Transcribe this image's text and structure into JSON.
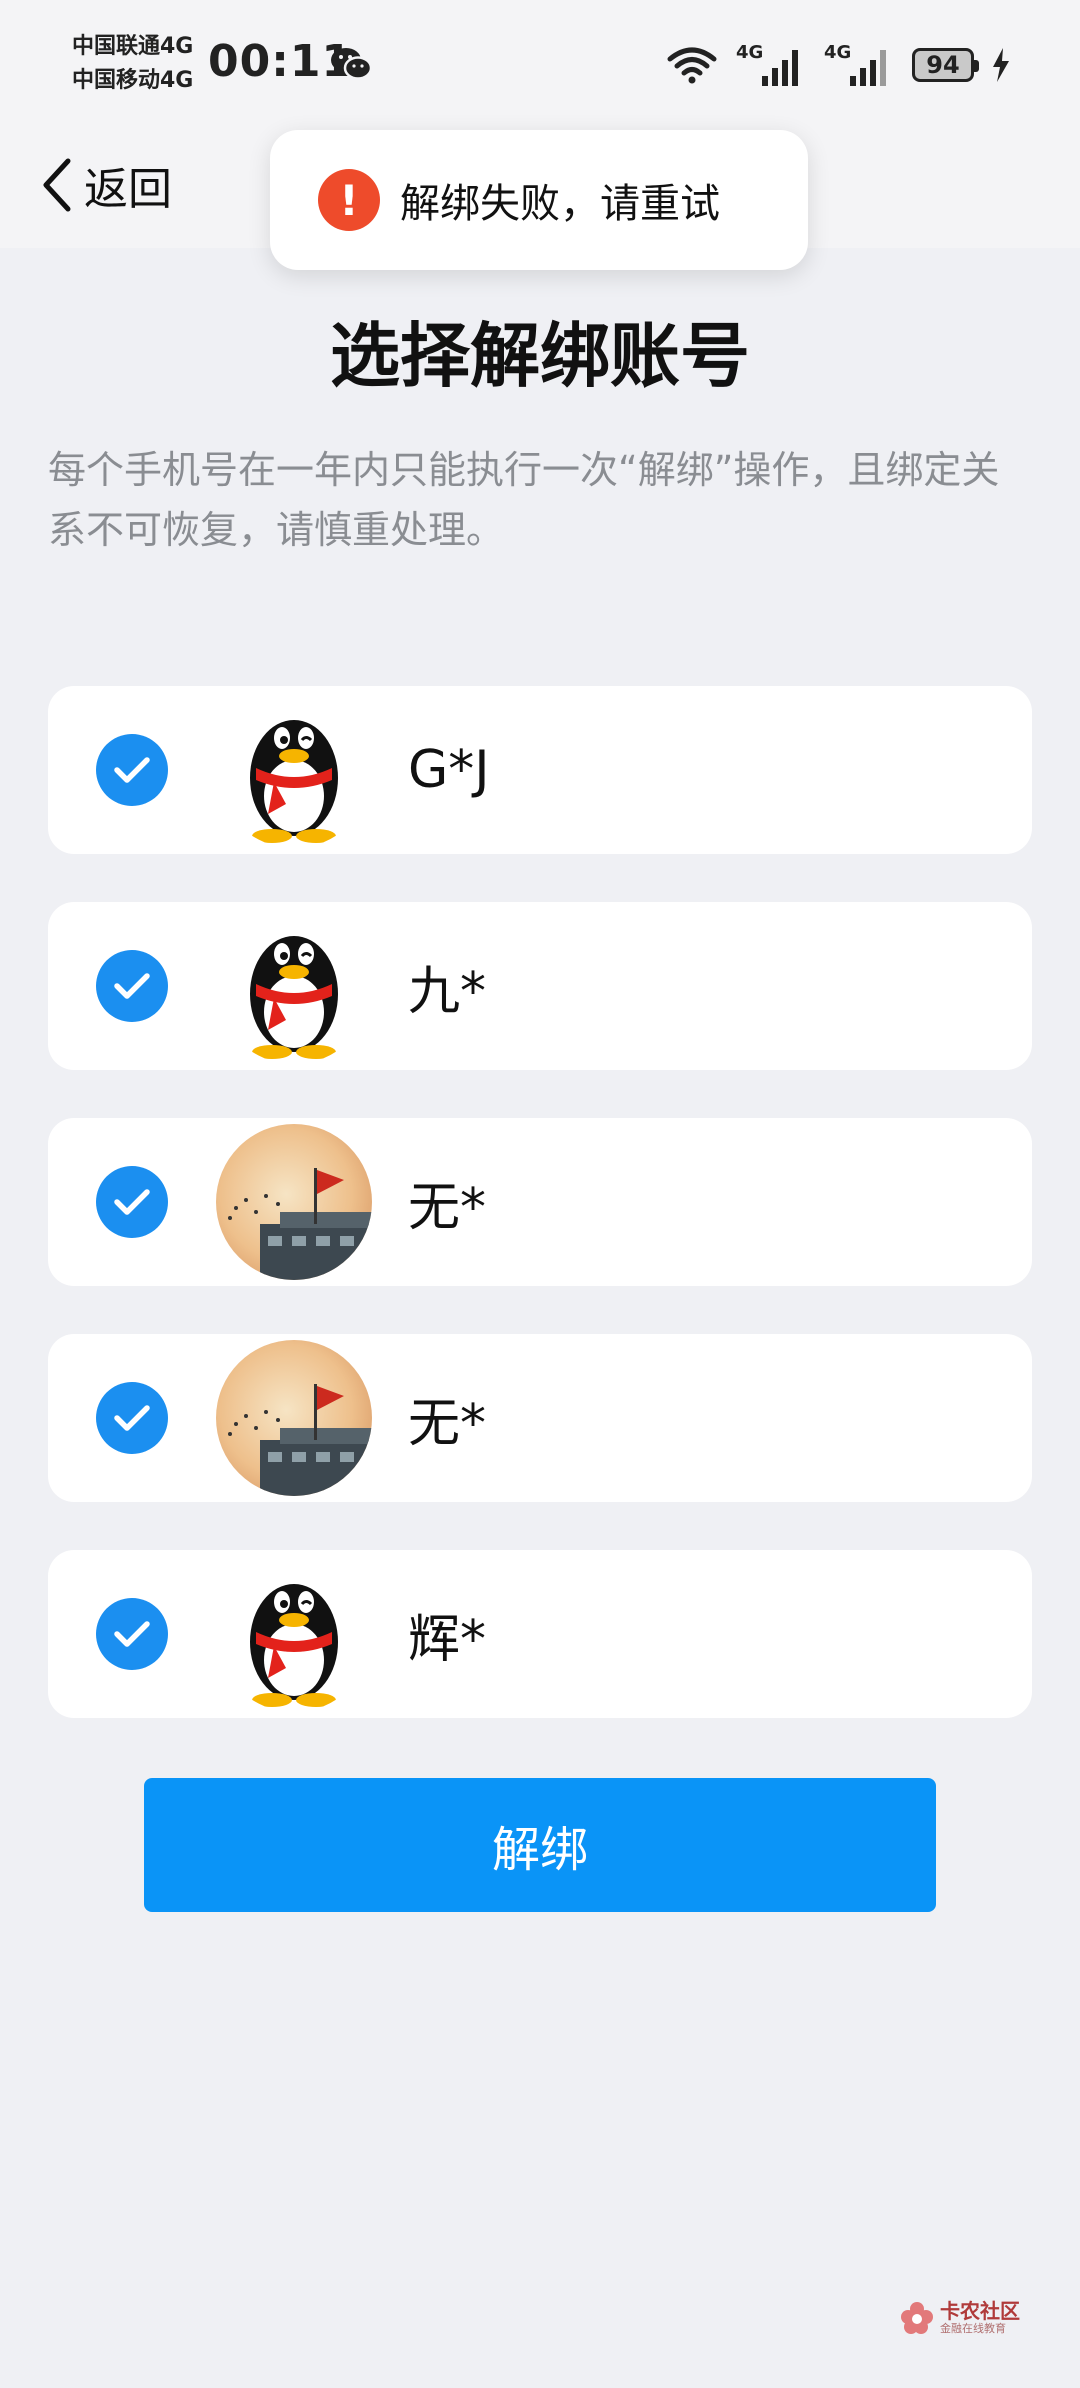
{
  "status_bar": {
    "carrier_1": "中国联通4G",
    "carrier_2": "中国移动4G",
    "time": "00:11",
    "signal_1_label": "4G",
    "signal_2_label": "4G",
    "battery": "94"
  },
  "nav": {
    "back_label": "返回"
  },
  "toast": {
    "message": "解绑失败，请重试",
    "icon": "!"
  },
  "page": {
    "title": "选择解绑账号",
    "notice": "每个手机号在一年内只能执行一次“解绑”操作，且绑定关系不可恢复，请慎重处理。"
  },
  "accounts": [
    {
      "name": "G*J",
      "checked": true,
      "avatar": "qq-penguin-icon"
    },
    {
      "name": "九*",
      "checked": true,
      "avatar": "qq-penguin-icon"
    },
    {
      "name": "无*",
      "checked": true,
      "avatar": "sunset-flag-photo"
    },
    {
      "name": "无*",
      "checked": true,
      "avatar": "sunset-flag-photo"
    },
    {
      "name": "辉*",
      "checked": true,
      "avatar": "qq-penguin-icon"
    }
  ],
  "actions": {
    "unbind_label": "解绑"
  },
  "watermark": {
    "text": "卡农社区",
    "subtext": "金融在线教育"
  },
  "colors": {
    "accent": "#0a94f7",
    "check": "#1b8ff0",
    "error": "#ee4b2b",
    "background": "#eff0f4"
  }
}
